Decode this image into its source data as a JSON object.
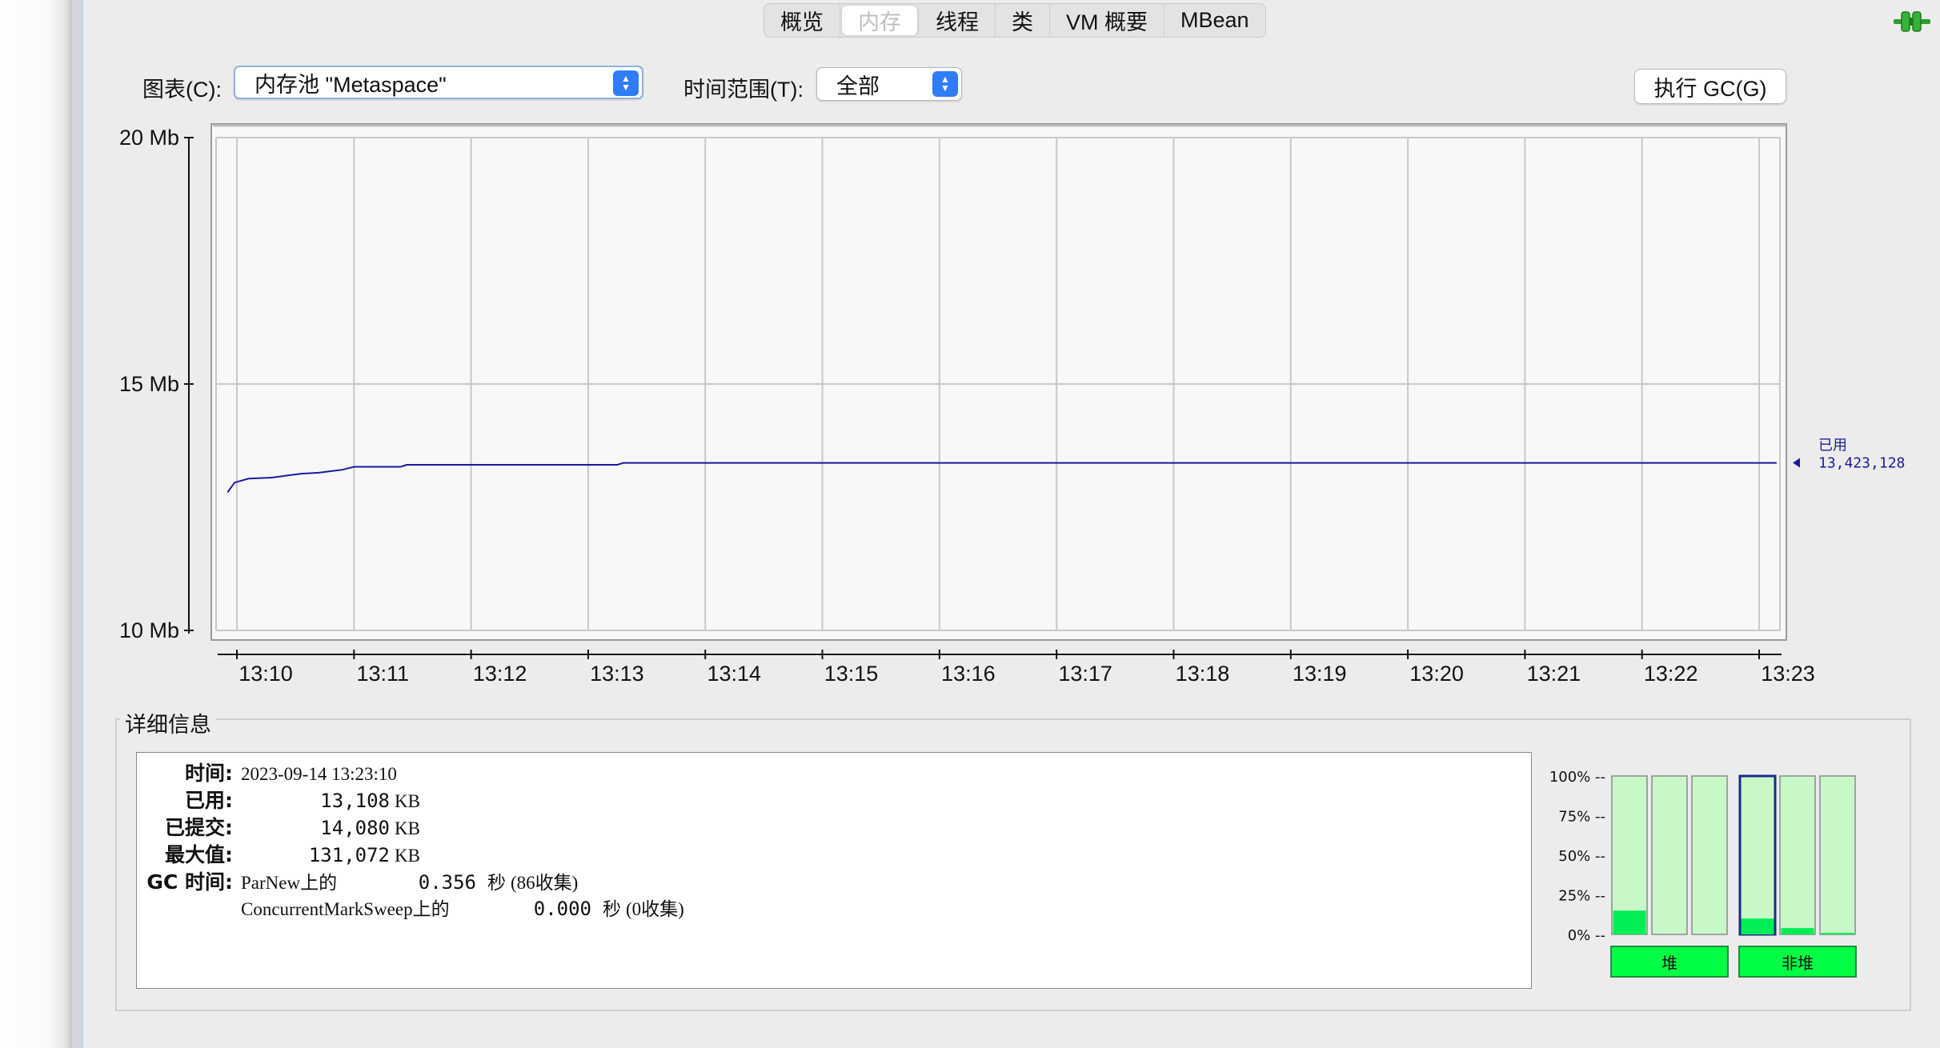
{
  "tabs": [
    {
      "label": "概览",
      "active": false
    },
    {
      "label": "内存",
      "active": true
    },
    {
      "label": "线程",
      "active": false
    },
    {
      "label": "类",
      "active": false
    },
    {
      "label": "VM 概要",
      "active": false
    },
    {
      "label": "MBean",
      "active": false
    }
  ],
  "controls": {
    "chart_label": "图表(C):",
    "chart_value": "内存池 \"Metaspace\"",
    "range_label": "时间范围(T):",
    "range_value": "全部",
    "gc_button": "执行 GC(G)"
  },
  "chart_data": {
    "type": "line",
    "y_ticks": [
      {
        "label": "20 Mb",
        "value": 20
      },
      {
        "label": "15 Mb",
        "value": 15
      },
      {
        "label": "10 Mb",
        "value": 10
      }
    ],
    "ylim": [
      10,
      20
    ],
    "x_ticks": [
      "13:10",
      "13:11",
      "13:12",
      "13:13",
      "13:14",
      "13:15",
      "13:16",
      "13:17",
      "13:18",
      "13:19",
      "13:20",
      "13:21",
      "13:22",
      "13:23"
    ],
    "xlim_minutes": [
      -0.1,
      13.15
    ],
    "grid": true,
    "series": [
      {
        "name": "已用",
        "latest_label": "13,423,128",
        "color": "#1a1aa0",
        "points": [
          {
            "t": -0.08,
            "mb": 12.8
          },
          {
            "t": -0.02,
            "mb": 13.0
          },
          {
            "t": 0.1,
            "mb": 13.08
          },
          {
            "t": 0.3,
            "mb": 13.1
          },
          {
            "t": 0.45,
            "mb": 13.15
          },
          {
            "t": 0.55,
            "mb": 13.18
          },
          {
            "t": 0.7,
            "mb": 13.2
          },
          {
            "t": 0.8,
            "mb": 13.23
          },
          {
            "t": 0.9,
            "mb": 13.26
          },
          {
            "t": 1.0,
            "mb": 13.32
          },
          {
            "t": 1.4,
            "mb": 13.32
          },
          {
            "t": 1.45,
            "mb": 13.36
          },
          {
            "t": 3.25,
            "mb": 13.36
          },
          {
            "t": 3.3,
            "mb": 13.4
          },
          {
            "t": 13.15,
            "mb": 13.4
          }
        ]
      }
    ]
  },
  "details": {
    "title": "详细信息",
    "time_label": "时间:",
    "time_value": "2023-09-14 13:23:10",
    "used_label": "已用:",
    "used_value": "13,108",
    "committed_label": "已提交:",
    "committed_value": "14,080",
    "max_label": "最大值:",
    "max_value": "131,072",
    "unit": "KB",
    "gc_label": "GC 时间:",
    "gc": [
      {
        "collector": "ParNew上的",
        "time": "0.356",
        "unit": "秒",
        "count": "(86收集)"
      },
      {
        "collector": "ConcurrentMarkSweep上的",
        "time": "0.000",
        "unit": "秒",
        "count": "(0收集)"
      }
    ]
  },
  "memory_bars": {
    "y_labels": [
      "100% --",
      "75% --",
      "50% --",
      "25% --",
      "0% --"
    ],
    "heap_button": "堆",
    "nonheap_button": "非堆",
    "heap_fill": [
      0.15,
      0.0,
      0.0
    ],
    "nonheap_fill": [
      0.1,
      0.04,
      0.01
    ],
    "selected_bar": 3
  },
  "colors": {
    "series": "#1a1aa0",
    "bar_bg": "#c8f7c8",
    "bar_fill": "#00ee55",
    "button_green": "#00ff44",
    "select_arrow": "#2f7cf6"
  }
}
